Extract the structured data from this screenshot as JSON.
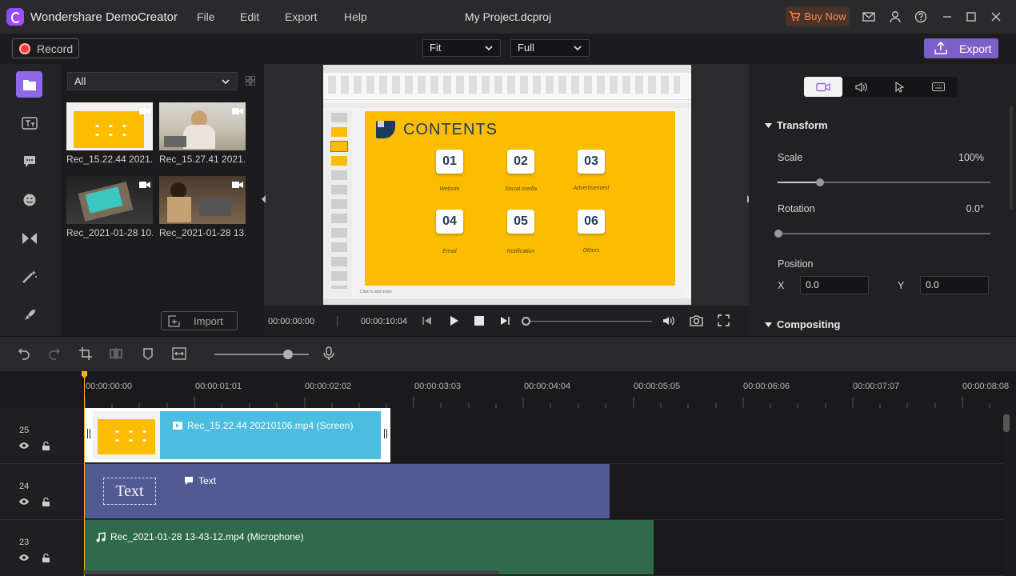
{
  "app": {
    "title": "Wondershare DemoCreator",
    "project": "My Project.dcproj",
    "menu": [
      "File",
      "Edit",
      "Export",
      "Help"
    ],
    "buy_now": "Buy Now"
  },
  "toolbar": {
    "record": "Record",
    "fit": "Fit",
    "quality": "Full",
    "export": "Export"
  },
  "library": {
    "filter": "All",
    "import": "Import",
    "items": [
      {
        "name": "Rec_15.22.44 2021..."
      },
      {
        "name": "Rec_15.27.41 2021..."
      },
      {
        "name": "Rec_2021-01-28 10..."
      },
      {
        "name": "Rec_2021-01-28 13..."
      }
    ]
  },
  "preview": {
    "slide_title": "CONTENTS",
    "boxes": [
      {
        "num": "01",
        "caption": "Website"
      },
      {
        "num": "02",
        "caption": "Social media"
      },
      {
        "num": "03",
        "caption": "Advertisement"
      },
      {
        "num": "04",
        "caption": "Email"
      },
      {
        "num": "05",
        "caption": "Notification"
      },
      {
        "num": "06",
        "caption": "Others"
      }
    ],
    "notes": "Click to add notes",
    "current_time": "00:00:00:00",
    "total_time": "00:00:10:04"
  },
  "properties": {
    "transform_label": "Transform",
    "scale_label": "Scale",
    "scale_value": "100%",
    "scale_fraction": 0.2,
    "rotation_label": "Rotation",
    "rotation_value": "0.0°",
    "position_label": "Position",
    "x_label": "X",
    "x_value": "0.0",
    "y_label": "Y",
    "y_value": "0.0",
    "compositing_label": "Compositing"
  },
  "timeline": {
    "ruler": [
      "00:00:00:00",
      "00:00:01:01",
      "00:00:02:02",
      "00:00:03:03",
      "00:00:04:04",
      "00:00:05:05",
      "00:00:06:06",
      "00:00:07:07",
      "00:00:08:08"
    ],
    "tracks": [
      {
        "num": "25",
        "clip": "Rec_15.22.44 20210106.mp4 (Screen)"
      },
      {
        "num": "24",
        "clip": "Text",
        "thumb_text": "Text"
      },
      {
        "num": "23",
        "clip": "Rec_2021-01-28 13-43-12.mp4 (Microphone)"
      }
    ]
  },
  "colors": {
    "accent": "#8e6ae6",
    "screen_clip": "#4bbde0",
    "text_clip": "#525a94",
    "audio_clip": "#2e6a4b",
    "playhead": "#ffb020"
  }
}
